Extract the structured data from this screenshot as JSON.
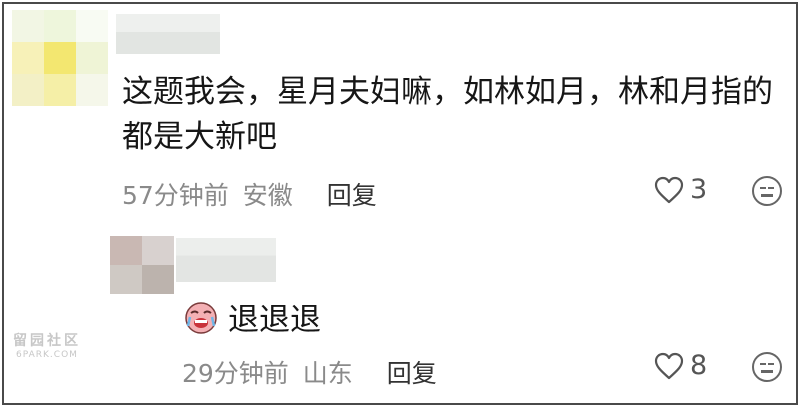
{
  "comment": {
    "avatar_colors": [
      "#f2f6e4",
      "#eef6dc",
      "#f8fbf3",
      "#f7f1b8",
      "#f3e770",
      "#eff4d6",
      "#f3f0c6",
      "#f5efa7",
      "#f5f7ea"
    ],
    "text": "这题我会，星月夫妇嘛，如林如月，林和月指的都是大新吧",
    "time": "57分钟前",
    "location": "安徽",
    "reply_label": "回复",
    "likes": "3"
  },
  "reply": {
    "avatar_colors": [
      "#c9b8b3",
      "#d8d1cf",
      "#cfc9c4",
      "#bcb3ad"
    ],
    "emoji": "crying-face",
    "text": "退退退",
    "time": "29分钟前",
    "location": "山东",
    "reply_label": "回复",
    "likes": "8"
  },
  "watermark": {
    "line1": "留园社区",
    "line2": "6PARK.COM"
  }
}
